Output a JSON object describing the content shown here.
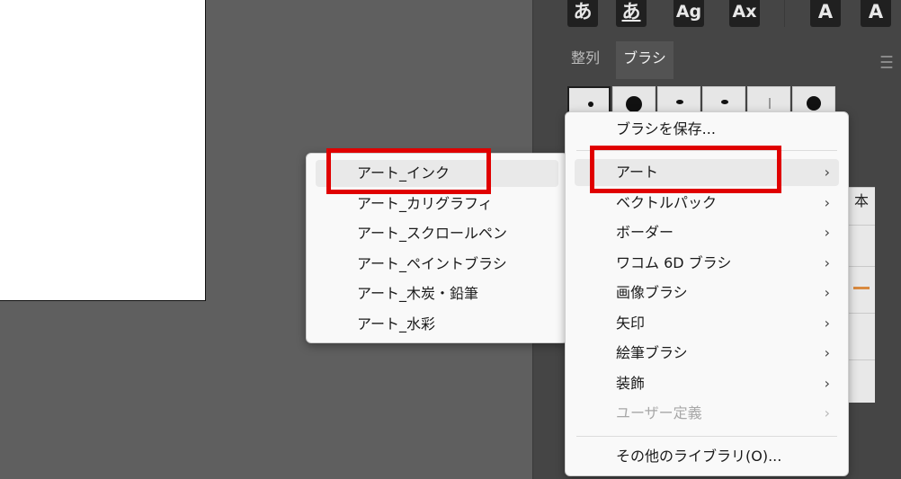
{
  "toolbar": {
    "buttons": [
      {
        "glyph": "あ"
      },
      {
        "glyph": "あ"
      },
      {
        "glyph": "Ag"
      },
      {
        "glyph": "Ax"
      },
      {
        "glyph": "A"
      },
      {
        "glyph": "A"
      }
    ]
  },
  "panel": {
    "tabs": [
      {
        "label": "整列"
      },
      {
        "label": "ブラシ"
      }
    ],
    "side_label": "本"
  },
  "brush_menu": {
    "items": [
      {
        "label": "ブラシを保存..."
      },
      {
        "label": "アート",
        "has_submenu": true
      },
      {
        "label": "ベクトルパック",
        "has_submenu": true
      },
      {
        "label": "ボーダー",
        "has_submenu": true
      },
      {
        "label": "ワコム 6D ブラシ",
        "has_submenu": true
      },
      {
        "label": "画像ブラシ",
        "has_submenu": true
      },
      {
        "label": "矢印",
        "has_submenu": true
      },
      {
        "label": "絵筆ブラシ",
        "has_submenu": true
      },
      {
        "label": "装飾",
        "has_submenu": true
      },
      {
        "label": "ユーザー定義",
        "has_submenu": true,
        "disabled": true
      },
      {
        "label": "その他のライブラリ(O)..."
      }
    ]
  },
  "art_submenu": {
    "items": [
      {
        "label": "アート_インク"
      },
      {
        "label": "アート_カリグラフィ"
      },
      {
        "label": "アート_スクロールペン"
      },
      {
        "label": "アート_ペイントブラシ"
      },
      {
        "label": "アート_木炭・鉛筆"
      },
      {
        "label": "アート_水彩"
      }
    ]
  },
  "colors": {
    "highlight_box": "#e00000",
    "canvas_bg": "#5f5f5f",
    "panel_bg": "#454545"
  }
}
